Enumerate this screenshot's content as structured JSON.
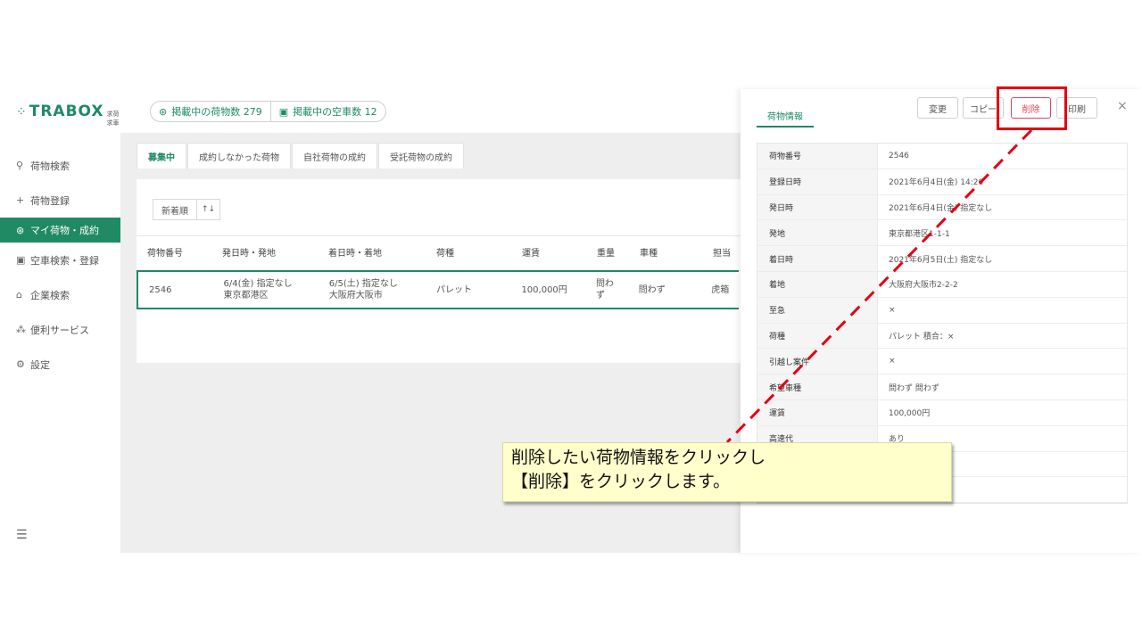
{
  "app": {
    "logo_text": "TRABOX",
    "logo_sub": "求荷求車",
    "logo_icon": "dots-logo-icon"
  },
  "header": {
    "cargo_count_label": "掲載中の荷物数 279",
    "truck_count_label": "掲載中の空車数 12"
  },
  "sidebar": {
    "items": [
      {
        "label": "荷物検索",
        "icon": "search-icon"
      },
      {
        "label": "荷物登録",
        "icon": "plus-icon"
      },
      {
        "label": "マイ荷物・成約",
        "icon": "cube-icon",
        "active": true
      },
      {
        "label": "空車検索・登録",
        "icon": "truck-icon"
      },
      {
        "label": "企業検索",
        "icon": "building-icon"
      },
      {
        "label": "便利サービス",
        "icon": "network-icon"
      },
      {
        "label": "設定",
        "icon": "gear-icon"
      }
    ]
  },
  "main": {
    "tabs": [
      "募集中",
      "成約しなかった荷物",
      "自社荷物の成約",
      "受託荷物の成約"
    ],
    "sort_label": "新着順",
    "sort_icon": "↑↓",
    "columns": [
      "荷物番号",
      "発日時・発地",
      "着日時・着地",
      "荷種",
      "運賃",
      "重量",
      "車種",
      "担当"
    ],
    "row": {
      "id": "2546",
      "depart_line1": "6/4(金) 指定なし",
      "depart_line2": "東京都港区",
      "arrive_line1": "6/5(土) 指定なし",
      "arrive_line2": "大阪府大阪市",
      "cargo_type": "パレット",
      "fare": "100,000円",
      "weight_line1": "問わ",
      "weight_line2": "ず",
      "vehicle": "問わず",
      "person": "虎箱"
    }
  },
  "panel": {
    "tab_label": "荷物情報",
    "buttons": {
      "edit": "変更",
      "copy": "コピー",
      "delete": "削除",
      "print": "印刷"
    },
    "close": "×",
    "rows": [
      {
        "k": "荷物番号",
        "v": "2546"
      },
      {
        "k": "登録日時",
        "v": "2021年6月4日(金) 14:20"
      },
      {
        "k": "発日時",
        "v": "2021年6月4日(金) 指定なし"
      },
      {
        "k": "発地",
        "v": "東京都港区1-1-1"
      },
      {
        "k": "着日時",
        "v": "2021年6月5日(土) 指定なし"
      },
      {
        "k": "着地",
        "v": "大阪府大阪市2-2-2"
      },
      {
        "k": "至急",
        "v": "×"
      },
      {
        "k": "荷種",
        "v": "パレット 積合：×"
      },
      {
        "k": "引越し案件",
        "v": "×"
      },
      {
        "k": "希望車種",
        "v": "問わず 問わず"
      },
      {
        "k": "運賃",
        "v": "100,000円"
      },
      {
        "k": "高速代",
        "v": "あり"
      },
      {
        "k": "",
        "v": ""
      },
      {
        "k": "",
        "v": ""
      }
    ]
  },
  "callout": {
    "line1": "削除したい荷物情報をクリックし",
    "line2": "【削除】をクリックします。"
  }
}
